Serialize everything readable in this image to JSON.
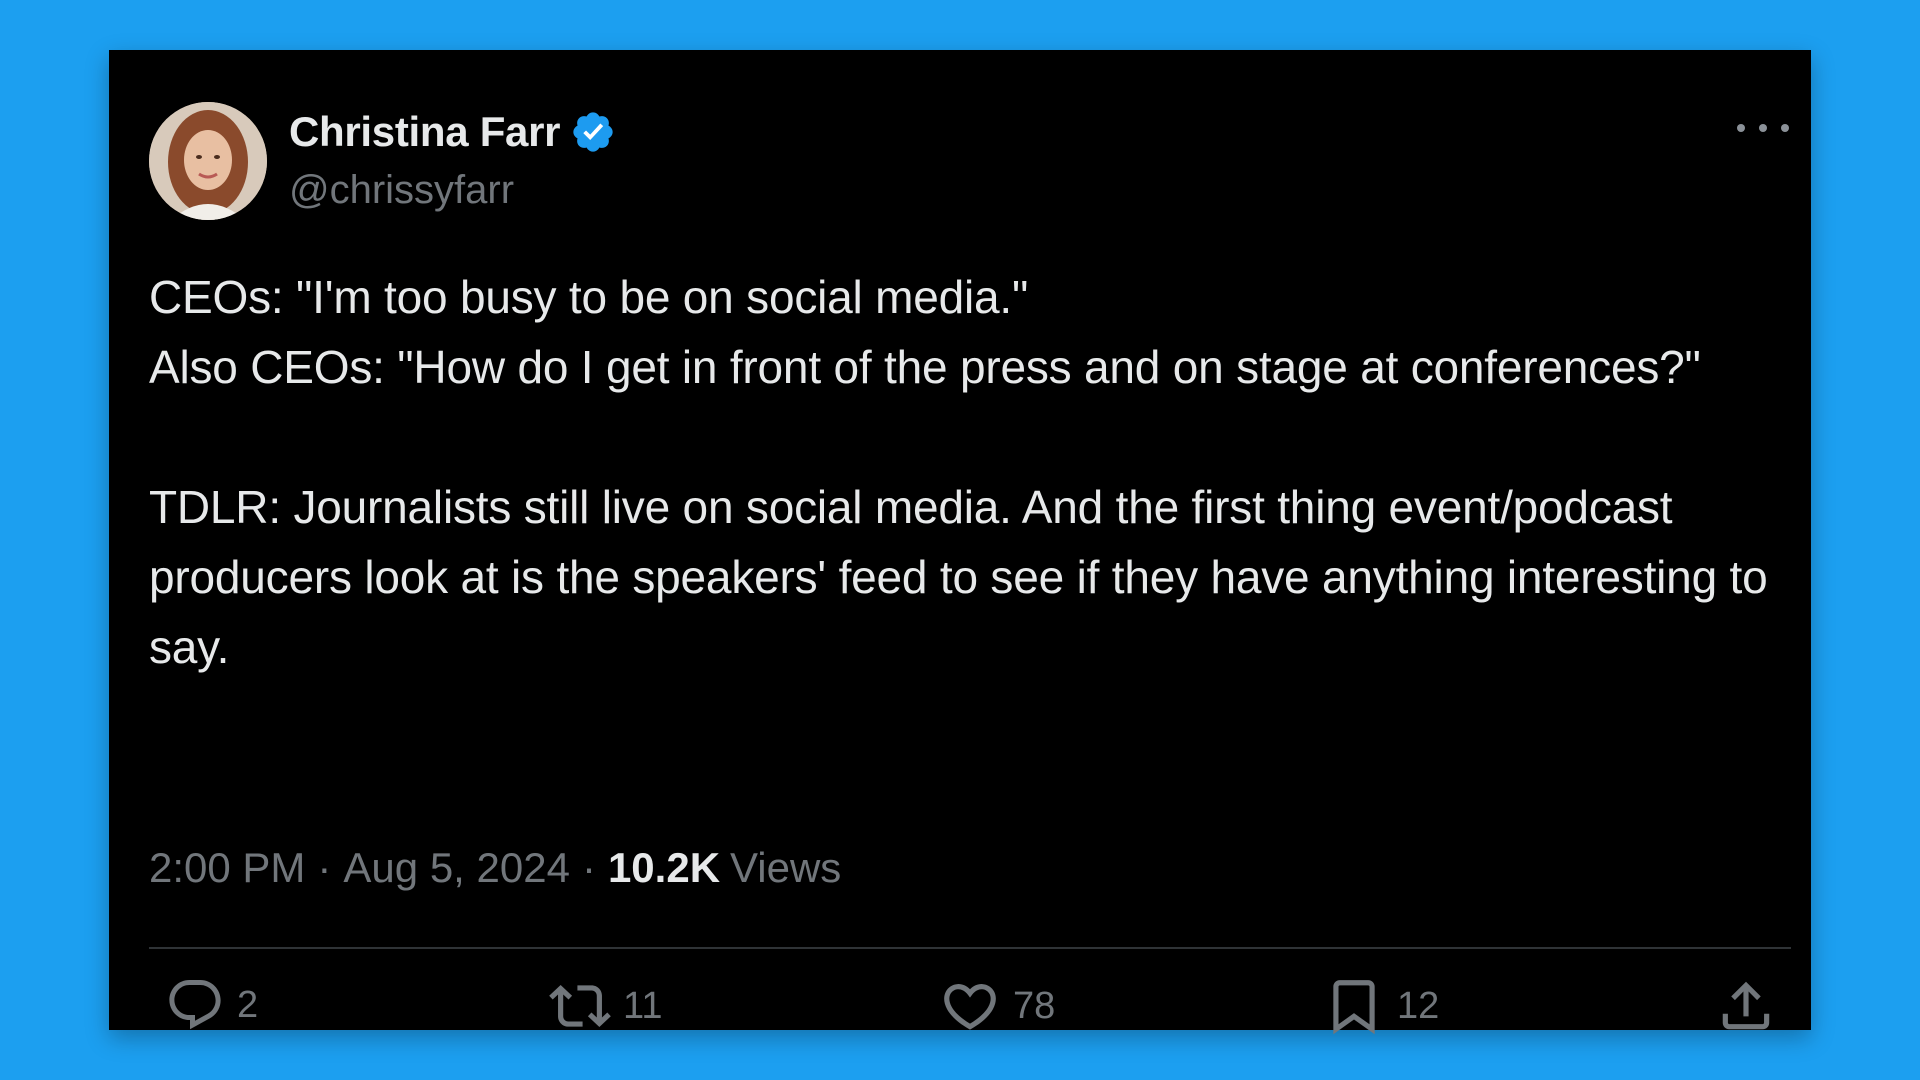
{
  "tweet": {
    "author": {
      "display_name": "Christina Farr",
      "handle": "@chrissyfarr",
      "verified": true
    },
    "text": "CEOs: \"I'm too busy to be on social media.\"\nAlso CEOs: \"How do I get in front of the press and on stage at conferences?\"\n\nTDLR: Journalists still live on social media. And the first thing event/podcast producers look at is the speakers' feed to see if they have anything interesting to say.",
    "time": "2:00 PM",
    "date": "Aug 5, 2024",
    "separator": "·",
    "views_count": "10.2K",
    "views_label": "Views",
    "actions": {
      "replies": "2",
      "retweets": "11",
      "likes": "78",
      "bookmarks": "12"
    }
  },
  "colors": {
    "background": "#1c9ff0",
    "card": "#000000",
    "text_primary": "#e7e9ea",
    "text_secondary": "#71767b",
    "verified": "#1d9bf0"
  },
  "icons": {
    "reply": "reply-icon",
    "retweet": "retweet-icon",
    "like": "heart-icon",
    "bookmark": "bookmark-icon",
    "share": "share-icon",
    "verified": "verified-badge-icon",
    "more": "more-icon"
  }
}
